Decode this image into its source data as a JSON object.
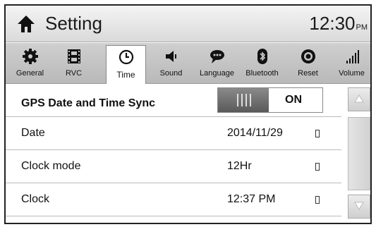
{
  "header": {
    "title": "Setting",
    "time": "12:30",
    "ampm": "PM"
  },
  "tabs": [
    {
      "label": "General",
      "icon": "gear-icon"
    },
    {
      "label": "RVC",
      "icon": "film-icon"
    },
    {
      "label": "Time",
      "icon": "clock-icon",
      "active": true
    },
    {
      "label": "Sound",
      "icon": "speaker-icon"
    },
    {
      "label": "Language",
      "icon": "speech-bubble-icon"
    },
    {
      "label": "Bluetooth",
      "icon": "bluetooth-icon"
    },
    {
      "label": "Reset",
      "icon": "reset-icon"
    },
    {
      "label": "Volume",
      "icon": "volume-bars-icon"
    }
  ],
  "settings": {
    "gps_sync": {
      "label": "GPS Date and Time Sync",
      "state": "ON"
    },
    "date": {
      "label": "Date",
      "value": "2014/11/29"
    },
    "clock_mode": {
      "label": "Clock mode",
      "value": "12Hr"
    },
    "clock": {
      "label": "Clock",
      "value": "12:37 PM"
    }
  },
  "colors": {
    "header_bg": "#e6e6e6",
    "tabbar_bg": "#c4c4c4",
    "toggle_knob": "#6e6e6e"
  }
}
